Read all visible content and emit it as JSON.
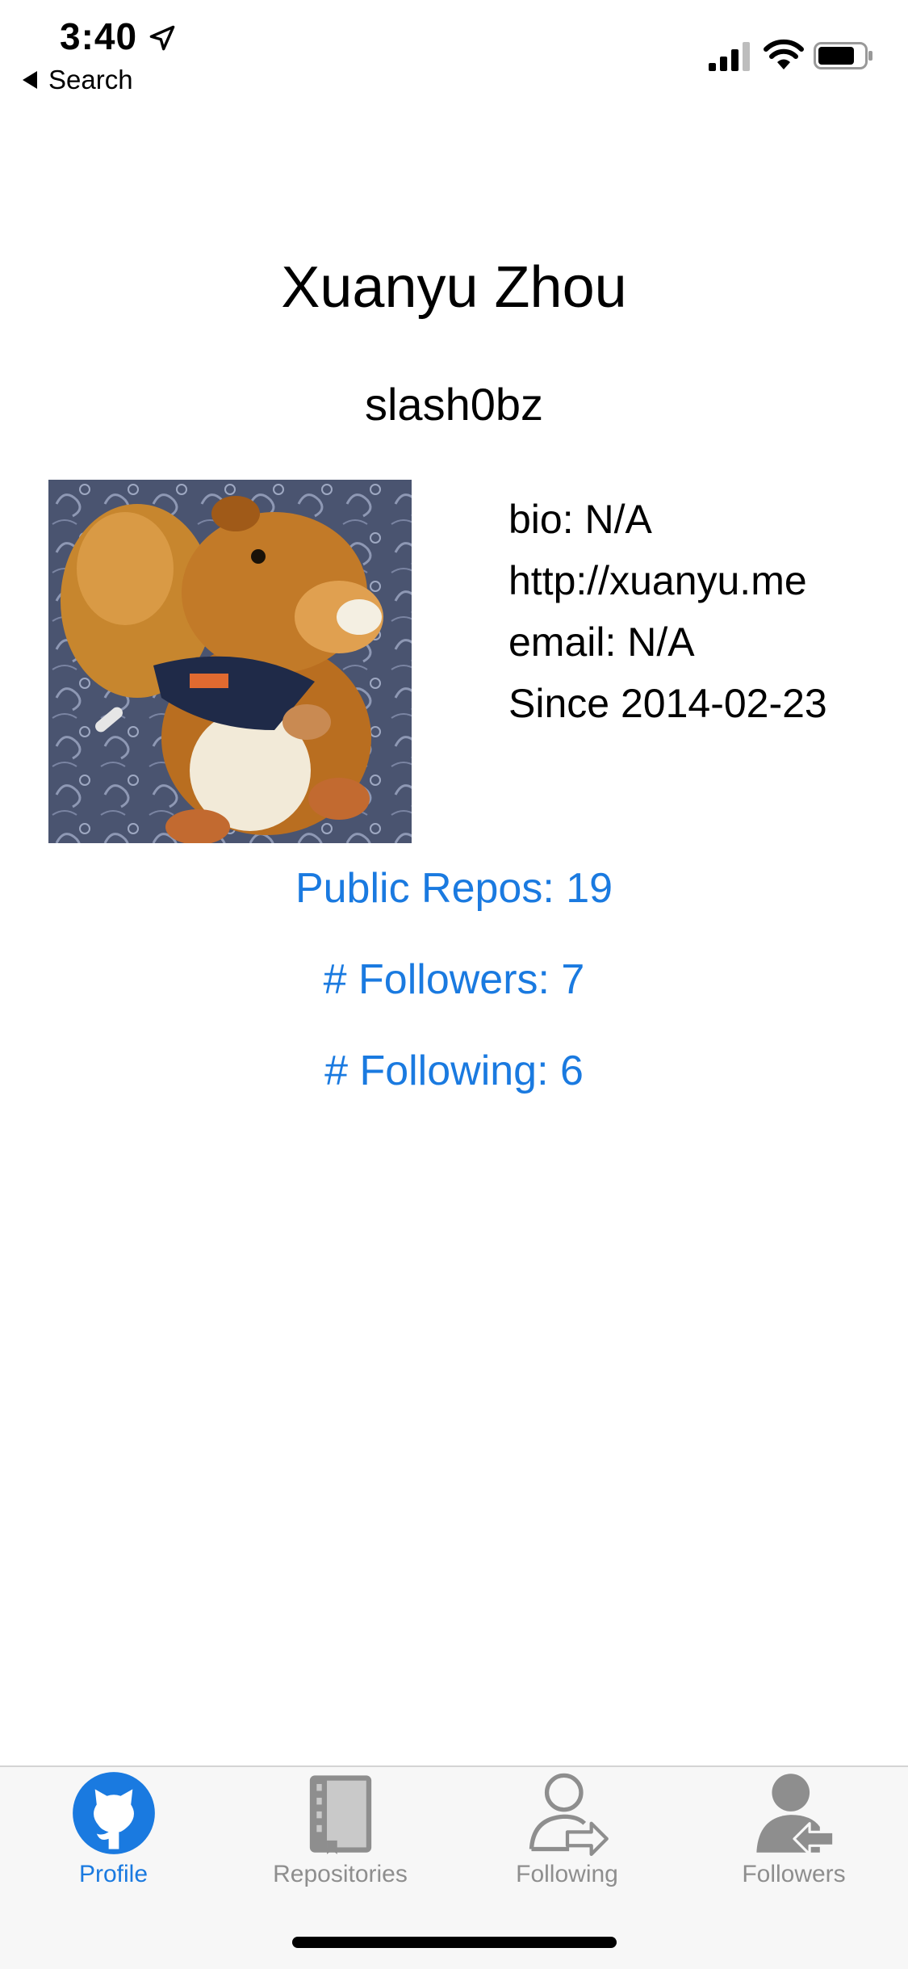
{
  "status_bar": {
    "time": "3:40",
    "back_label": "Search",
    "icons": [
      "location-arrow-icon",
      "signal-icon",
      "wifi-icon",
      "battery-icon"
    ]
  },
  "profile": {
    "name": "Xuanyu Zhou",
    "login": "slash0bz",
    "avatar": "plush-squirrel-photo",
    "bio": "bio: N/A",
    "blog": "http://xuanyu.me",
    "email": "email: N/A",
    "since": "Since 2014-02-23"
  },
  "stats": {
    "public_repos": "Public Repos: 19",
    "followers": "# Followers: 7",
    "following": "# Following: 6"
  },
  "tab_bar": {
    "active": "Profile",
    "tabs": [
      {
        "label": "Profile",
        "icon": "github-octocat-icon"
      },
      {
        "label": "Repositories",
        "icon": "book-icon"
      },
      {
        "label": "Following",
        "icon": "user-arrow-right-icon"
      },
      {
        "label": "Followers",
        "icon": "user-arrow-left-icon"
      }
    ]
  },
  "colors": {
    "accent": "#1a7ae0",
    "tab_inactive": "#8e8e8e",
    "tab_bar_bg": "#f7f7f7"
  }
}
